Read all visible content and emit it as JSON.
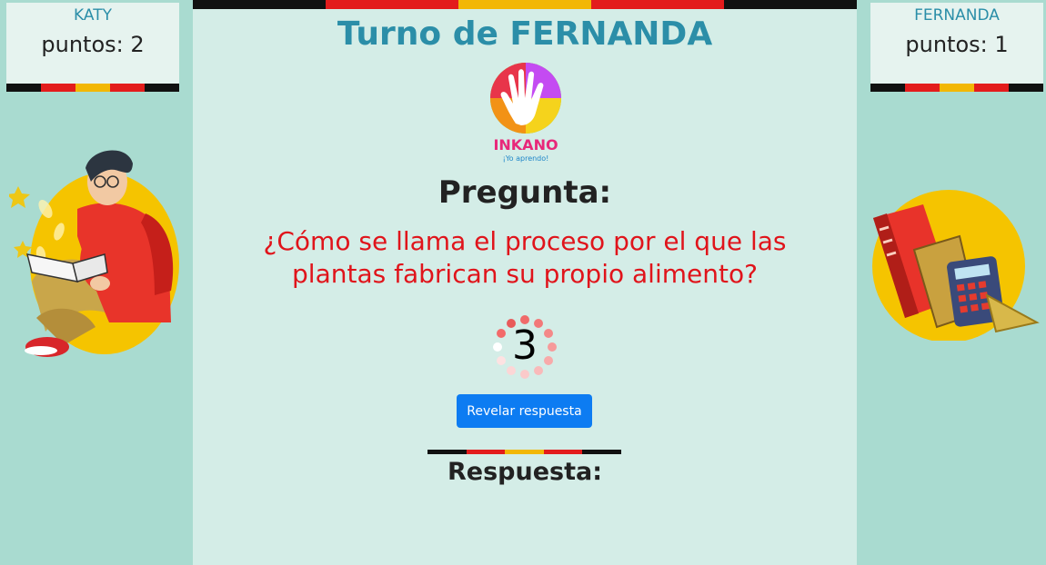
{
  "players": {
    "left": {
      "name": "KATY",
      "points_label": "puntos: 2"
    },
    "right": {
      "name": "FERNANDA",
      "points_label": "puntos: 1"
    }
  },
  "turn_title": "Turno de FERNANDA",
  "logo": {
    "brand": "INKANO",
    "tagline": "¡Yo aprendo!"
  },
  "question": {
    "heading": "Pregunta:",
    "text": "¿Cómo se llama el proceso por el que las plantas fabrican su propio alimento?"
  },
  "countdown": {
    "value": "3"
  },
  "reveal_button_label": "Revelar respuesta",
  "answer_heading": "Respuesta:",
  "colors": {
    "stripe": [
      "#111111",
      "#e31c1c",
      "#f2b705",
      "#e31c1c",
      "#111111"
    ],
    "title": "#2b8ea8",
    "question": "#e0141b",
    "button": "#0d7cf2",
    "background": "#a9dbd0"
  }
}
